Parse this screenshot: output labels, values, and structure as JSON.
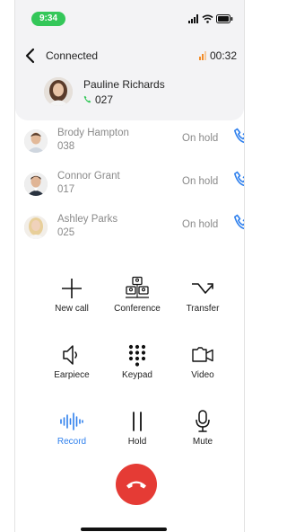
{
  "status_bar": {
    "time": "9:34"
  },
  "header": {
    "title": "Connected",
    "duration": "00:32"
  },
  "active_call": {
    "name": "Pauline Richards",
    "ext": "027"
  },
  "held_calls": [
    {
      "name": "Brody Hampton",
      "ext": "038",
      "status": "On hold"
    },
    {
      "name": "Connor Grant",
      "ext": "017",
      "status": "On hold"
    },
    {
      "name": "Ashley Parks",
      "ext": "025",
      "status": "On hold"
    }
  ],
  "actions": {
    "new_call": "New call",
    "conference": "Conference",
    "transfer": "Transfer",
    "earpiece": "Earpiece",
    "keypad": "Keypad",
    "video": "Video",
    "record": "Record",
    "hold": "Hold",
    "mute": "Mute"
  },
  "colors": {
    "accent": "#2f80ed",
    "end_call": "#e53b35",
    "call_green": "#34c759",
    "signal_orange": "#f28c28"
  }
}
